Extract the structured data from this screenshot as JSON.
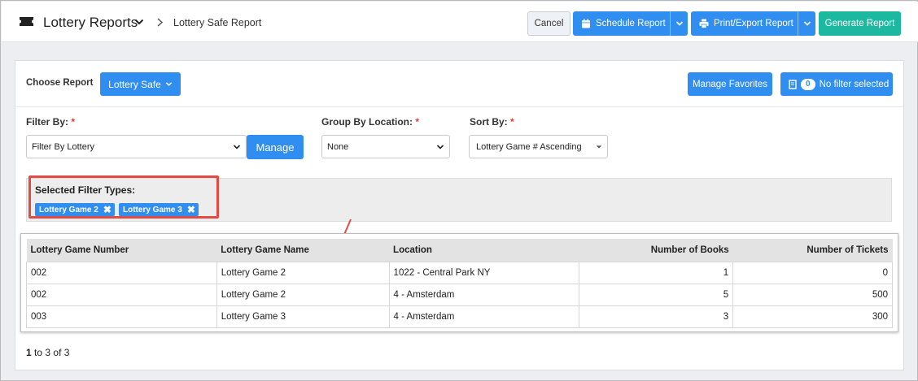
{
  "header": {
    "app_title": "Lottery Reports",
    "breadcrumb_current": "Lottery Safe Report",
    "cancel_label": "Cancel",
    "schedule_label": "Schedule Report",
    "print_label": "Print/Export Report",
    "generate_label": "Generate Report",
    "icons": [
      "ticket-icon",
      "chevron-down-icon",
      "chevron-right-icon",
      "calendar-icon",
      "printer-icon"
    ]
  },
  "report": {
    "choose_label": "Choose Report",
    "selected_report": "Lottery Safe",
    "manage_favorites_label": "Manage Favorites",
    "filter_count": "0",
    "no_filter_label": "No filter selected"
  },
  "filters": {
    "filter_by_label": "Filter By:",
    "filter_by_value": "Filter By Lottery",
    "manage_label": "Manage",
    "group_by_label": "Group By Location:",
    "group_by_value": "None",
    "sort_by_label": "Sort By:",
    "sort_by_value": "Lottery Game # Ascending",
    "required_mark": "*"
  },
  "selected_filters": {
    "title": "Selected Filter Types:",
    "chips": [
      "Lottery Game 2",
      "Lottery Game 3"
    ]
  },
  "table": {
    "columns": [
      "Lottery Game Number",
      "Lottery Game Name",
      "Location",
      "Number of Books",
      "Number of Tickets"
    ],
    "rows": [
      [
        "002",
        "Lottery Game 2",
        "1022 - Central Park NY",
        "1",
        "0"
      ],
      [
        "002",
        "Lottery Game 2",
        "4 - Amsterdam",
        "5",
        "500"
      ],
      [
        "003",
        "Lottery Game 3",
        "4 - Amsterdam",
        "3",
        "300"
      ]
    ]
  },
  "pagination": {
    "from": "1",
    "to_word": "to",
    "to": "3",
    "of_word": "of",
    "total": "3"
  },
  "colors": {
    "primary": "#2f8ef0",
    "generate": "#1cb8a0",
    "highlight": "#e24a44",
    "required": "#e53935"
  }
}
